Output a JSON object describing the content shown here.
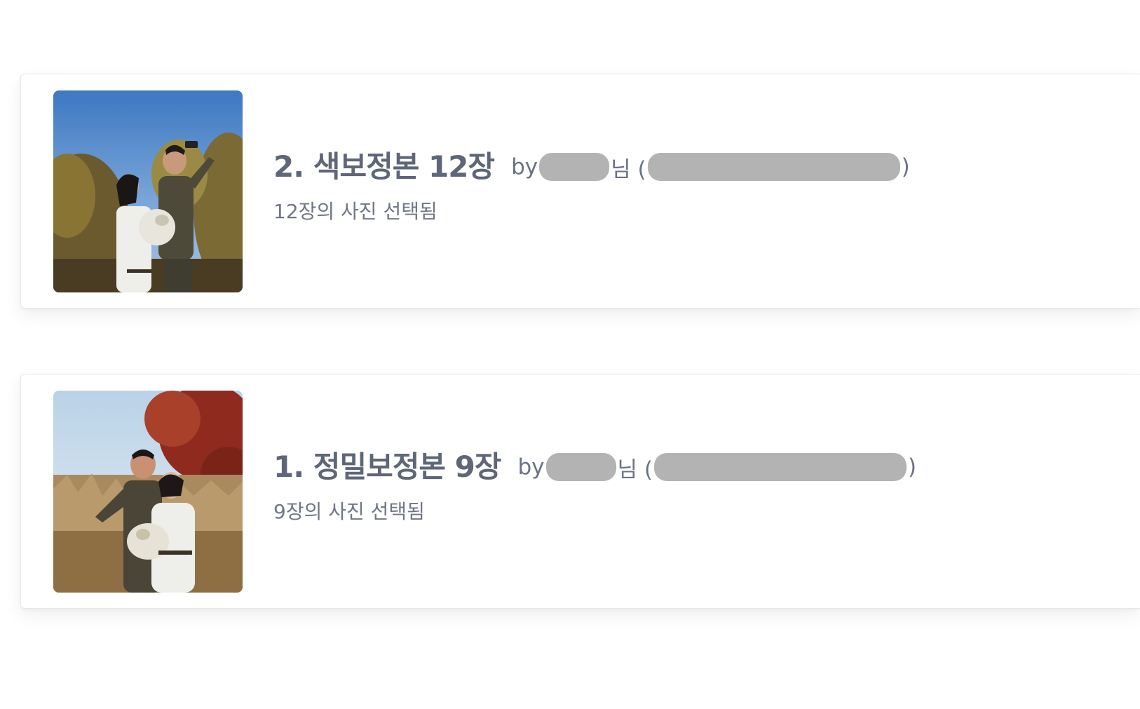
{
  "entries": [
    {
      "title": "2. 색보정본 12장",
      "by_label": "by",
      "honorific": "님 (",
      "close_paren": ")",
      "subtitle": "12장의 사진 선택됨"
    },
    {
      "title": "1. 정밀보정본 9장",
      "by_label": "by",
      "honorific": "님 (",
      "close_paren": ")",
      "subtitle": "9장의 사진 선택됨"
    }
  ],
  "colors": {
    "title": "#5e6678",
    "subtitle": "#6f7686",
    "redaction": "#b3b3b3",
    "card_border": "#e6e8ec"
  }
}
